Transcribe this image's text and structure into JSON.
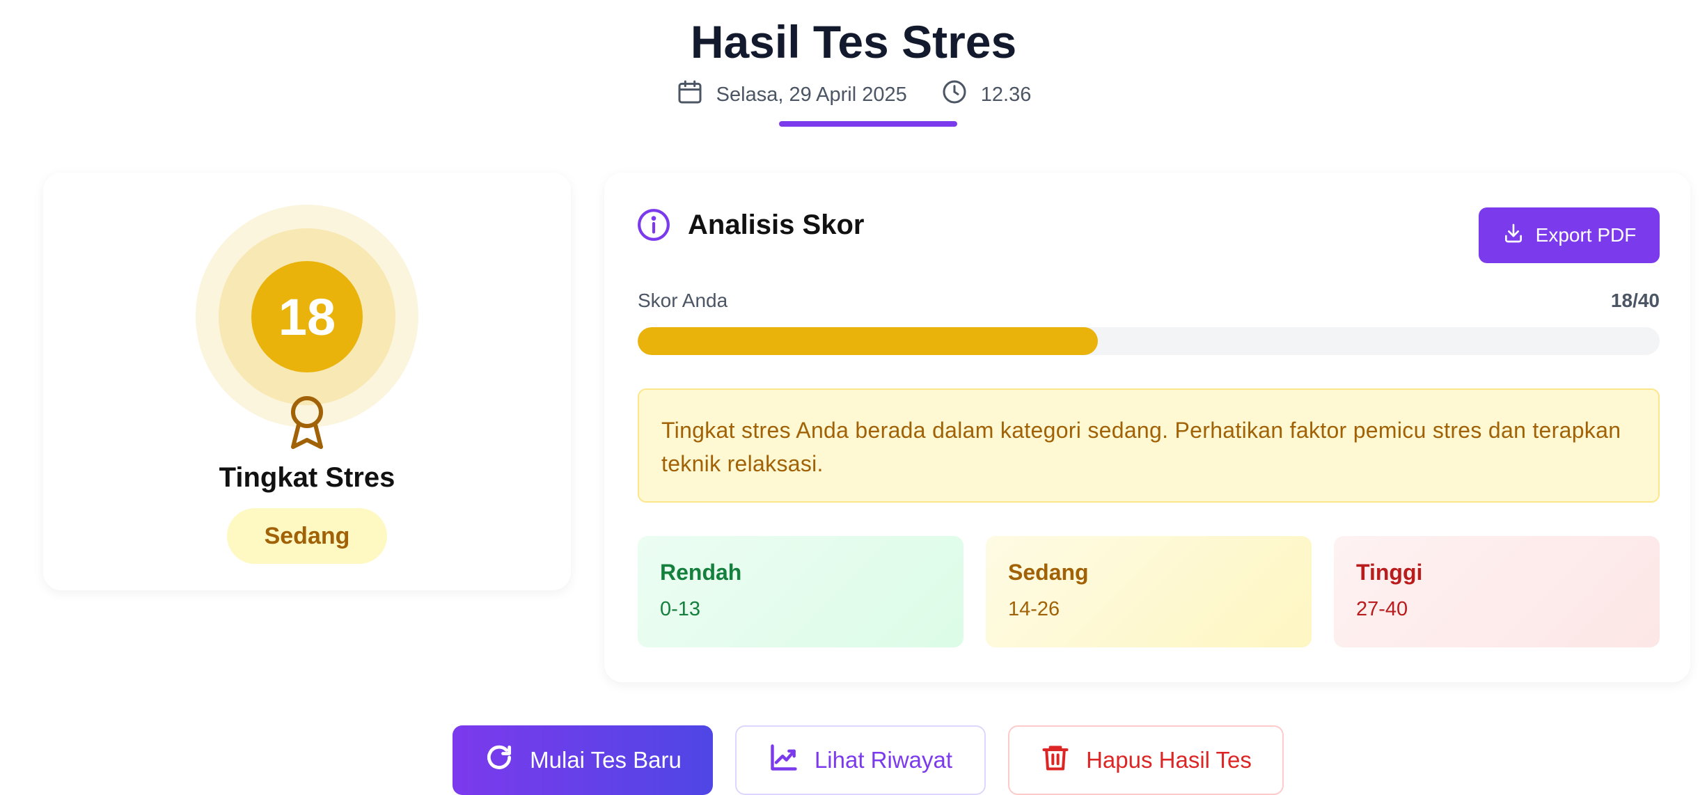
{
  "header": {
    "title": "Hasil Tes Stres",
    "date": "Selasa, 29 April 2025",
    "time": "12.36"
  },
  "summary": {
    "score": "18",
    "level_label": "Tingkat Stres",
    "level": "Sedang"
  },
  "analysis": {
    "title": "Analisis Skor",
    "export_label": "Export PDF",
    "score_label": "Skor Anda",
    "score_text": "18/40",
    "score_fraction": 0.45,
    "note": "Tingkat stres Anda berada dalam kategori sedang. Perhatikan faktor pemicu stres dan terapkan teknik relaksasi.",
    "ranges": [
      {
        "name": "Rendah",
        "range": "0-13"
      },
      {
        "name": "Sedang",
        "range": "14-26"
      },
      {
        "name": "Tinggi",
        "range": "27-40"
      }
    ]
  },
  "actions": {
    "new_test": "Mulai Tes Baru",
    "history": "Lihat Riwayat",
    "delete": "Hapus Hasil Tes"
  },
  "colors": {
    "accent": "#7c3aed",
    "level_moderate": "#e9b30c"
  },
  "icons": [
    "calendar-icon",
    "clock-icon",
    "award-icon",
    "info-icon",
    "download-icon",
    "refresh-icon",
    "chart-line-icon",
    "trash-icon"
  ]
}
